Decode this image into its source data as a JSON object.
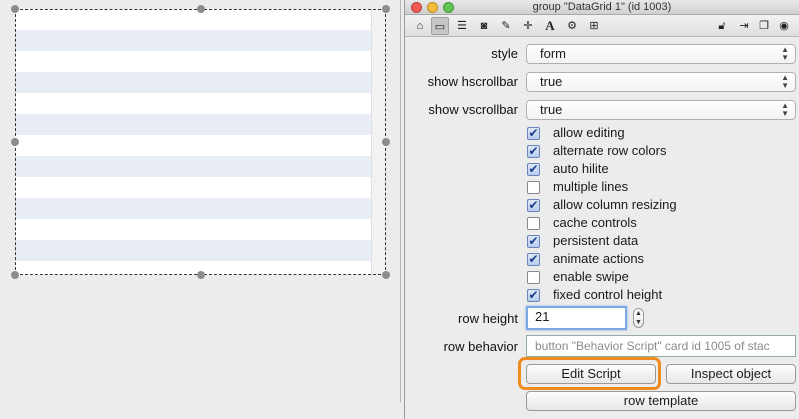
{
  "window": {
    "title": "group \"DataGrid 1\" (id 1003)"
  },
  "toolbar": {
    "left_icons": [
      "home-icon",
      "basic-properties-icon",
      "list-icon",
      "database-icon",
      "pencil-icon",
      "move-icon",
      "text-icon",
      "gears-icon",
      "grid-icon"
    ],
    "right_icons": [
      "lock-icon",
      "export-icon",
      "copy-icon",
      "target-icon"
    ]
  },
  "properties": {
    "style": {
      "label": "style",
      "value": "form"
    },
    "hscroll": {
      "label": "show hscrollbar",
      "value": "true"
    },
    "vscroll": {
      "label": "show vscrollbar",
      "value": "true"
    }
  },
  "checkboxes": [
    {
      "label": "allow editing",
      "checked": true
    },
    {
      "label": "alternate row colors",
      "checked": true
    },
    {
      "label": "auto hilite",
      "checked": true
    },
    {
      "label": "multiple lines",
      "checked": false
    },
    {
      "label": "allow column resizing",
      "checked": true
    },
    {
      "label": "cache controls",
      "checked": false
    },
    {
      "label": "persistent data",
      "checked": true
    },
    {
      "label": "animate actions",
      "checked": true
    },
    {
      "label": "enable swipe",
      "checked": false
    },
    {
      "label": "fixed control height",
      "checked": true
    }
  ],
  "row_height": {
    "label": "row height",
    "value": "21"
  },
  "row_behavior": {
    "label": "row behavior",
    "value": "button \"Behavior Script\" card  id 1005 of stac"
  },
  "buttons": {
    "edit_script": "Edit Script",
    "inspect_object": "Inspect object",
    "row_template": "row template"
  },
  "colors": {
    "alt_row": "#e8edf6",
    "highlight": "#ef8a1e",
    "focus_ring": "#7ca8e6"
  }
}
